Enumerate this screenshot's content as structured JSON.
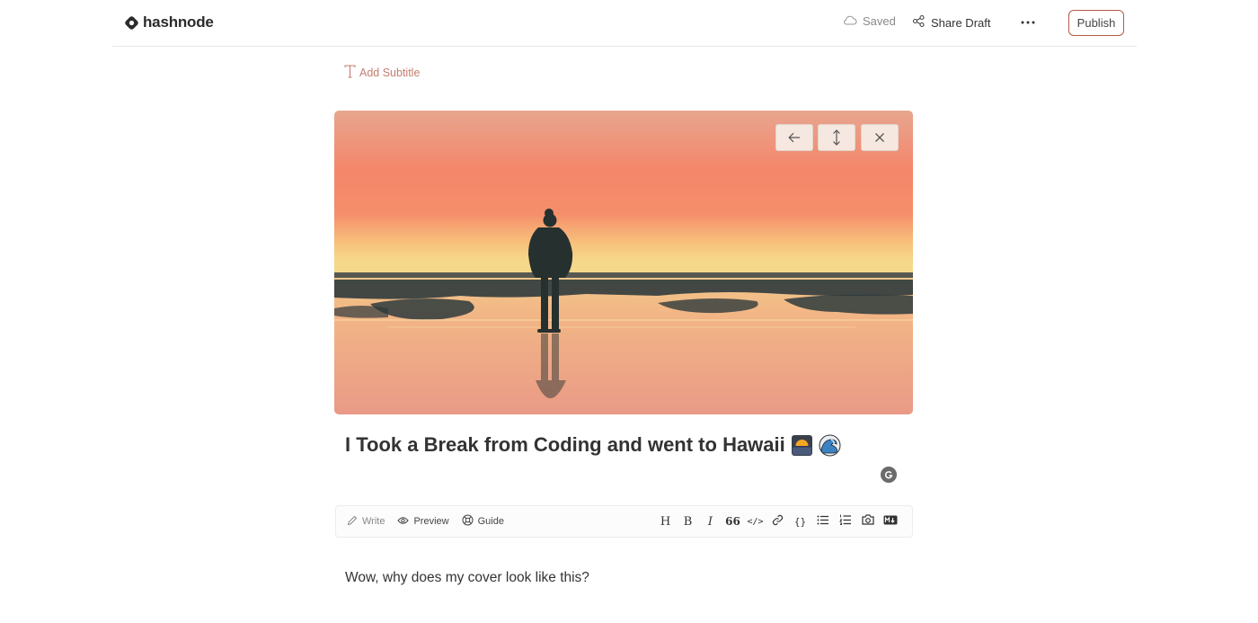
{
  "header": {
    "brand": "hashnode",
    "saved_label": "Saved",
    "share_label": "Share Draft",
    "more_label": "•••",
    "publish_label": "Publish"
  },
  "editor": {
    "subtitle_label": "Add Subtitle",
    "cover_buttons": [
      "arrow-left-icon",
      "resize-vertical-icon",
      "close-icon"
    ],
    "title": "I Took a Break from Coding and went to Hawaii",
    "title_emojis": [
      "sunset-emoji",
      "wave-emoji"
    ],
    "toolbar": {
      "tabs": [
        "Write",
        "Preview",
        "Guide"
      ],
      "format_icons": [
        "H",
        "B",
        "I",
        "66",
        "</>",
        "link",
        "{}",
        "bullet-list",
        "numbered-list",
        "camera",
        "M↓"
      ]
    },
    "body": "Wow, why does my cover look like this?"
  },
  "colors": {
    "accent": "#b45a4a",
    "subtitle": "#c57d6e",
    "sky_top": "#e9a48d",
    "sky_mid": "#f4866a",
    "horizon": "#f5c37a",
    "silhouette": "#2e3a3e"
  }
}
